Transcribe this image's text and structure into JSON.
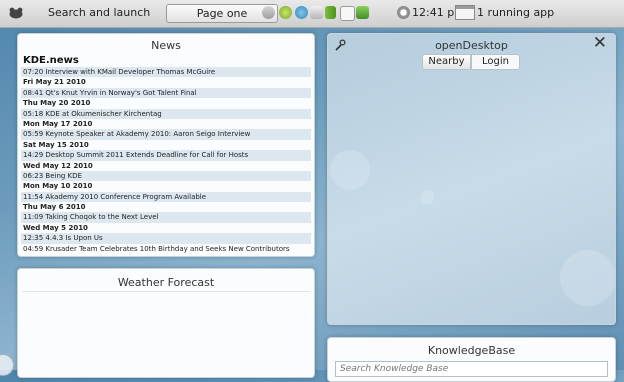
{
  "panel": {
    "launcher_label": "Search and launch",
    "page_button": "Page one",
    "clock": "12:41 pm",
    "running_apps": "1 running app",
    "tray_icons": [
      "network-icon",
      "update-ok-icon",
      "kde-connect-icon",
      "klipper-icon",
      "battery-icon",
      "notes-icon",
      "bag-icon"
    ]
  },
  "news": {
    "title": "News",
    "source": "KDE.news",
    "rows": [
      {
        "text": "07:20 Interview with KMail Developer Thomas McGuire",
        "date": false
      },
      {
        "text": "Fri May 21 2010",
        "date": true
      },
      {
        "text": "08:41 Qt's Knut Yrvin in Norway's Got Talent Final",
        "date": false
      },
      {
        "text": "Thu May 20 2010",
        "date": true
      },
      {
        "text": "05:18 KDE at Okumenischer Kirchentag",
        "date": false
      },
      {
        "text": "Mon May 17 2010",
        "date": true
      },
      {
        "text": "05:59 Keynote Speaker at Akademy 2010: Aaron Seigo Interview",
        "date": false
      },
      {
        "text": "Sat May 15 2010",
        "date": true
      },
      {
        "text": "14:29 Desktop Summit 2011 Extends Deadline for Call for Hosts",
        "date": false
      },
      {
        "text": "Wed May 12 2010",
        "date": true
      },
      {
        "text": "06:23 Being KDE",
        "date": false
      },
      {
        "text": "Mon May 10 2010",
        "date": true
      },
      {
        "text": "11:54 Akademy 2010 Conference Program Available",
        "date": false
      },
      {
        "text": "Thu May 6 2010",
        "date": true
      },
      {
        "text": "11:09 Taking Choqok to the Next Level",
        "date": false
      },
      {
        "text": "Wed May 5 2010",
        "date": true
      },
      {
        "text": "12:35 4.4.3 Is Upon Us",
        "date": false
      },
      {
        "text": "04:59 Krusader Team Celebrates 10th Birthday and Seeks New Contributors",
        "date": false
      }
    ]
  },
  "weather": {
    "title": "Weather Forecast"
  },
  "opendesktop": {
    "title": "openDesktop",
    "tabs": [
      "Nearby",
      "Login"
    ],
    "close_label": "✕"
  },
  "knowledgebase": {
    "title": "KnowledgeBase",
    "search_placeholder": "Search Knowledge Base"
  },
  "colors": {
    "wallpaper": "#6c9cbd",
    "panel": "#dcdcdc",
    "row_alt": "#dde7ef"
  }
}
